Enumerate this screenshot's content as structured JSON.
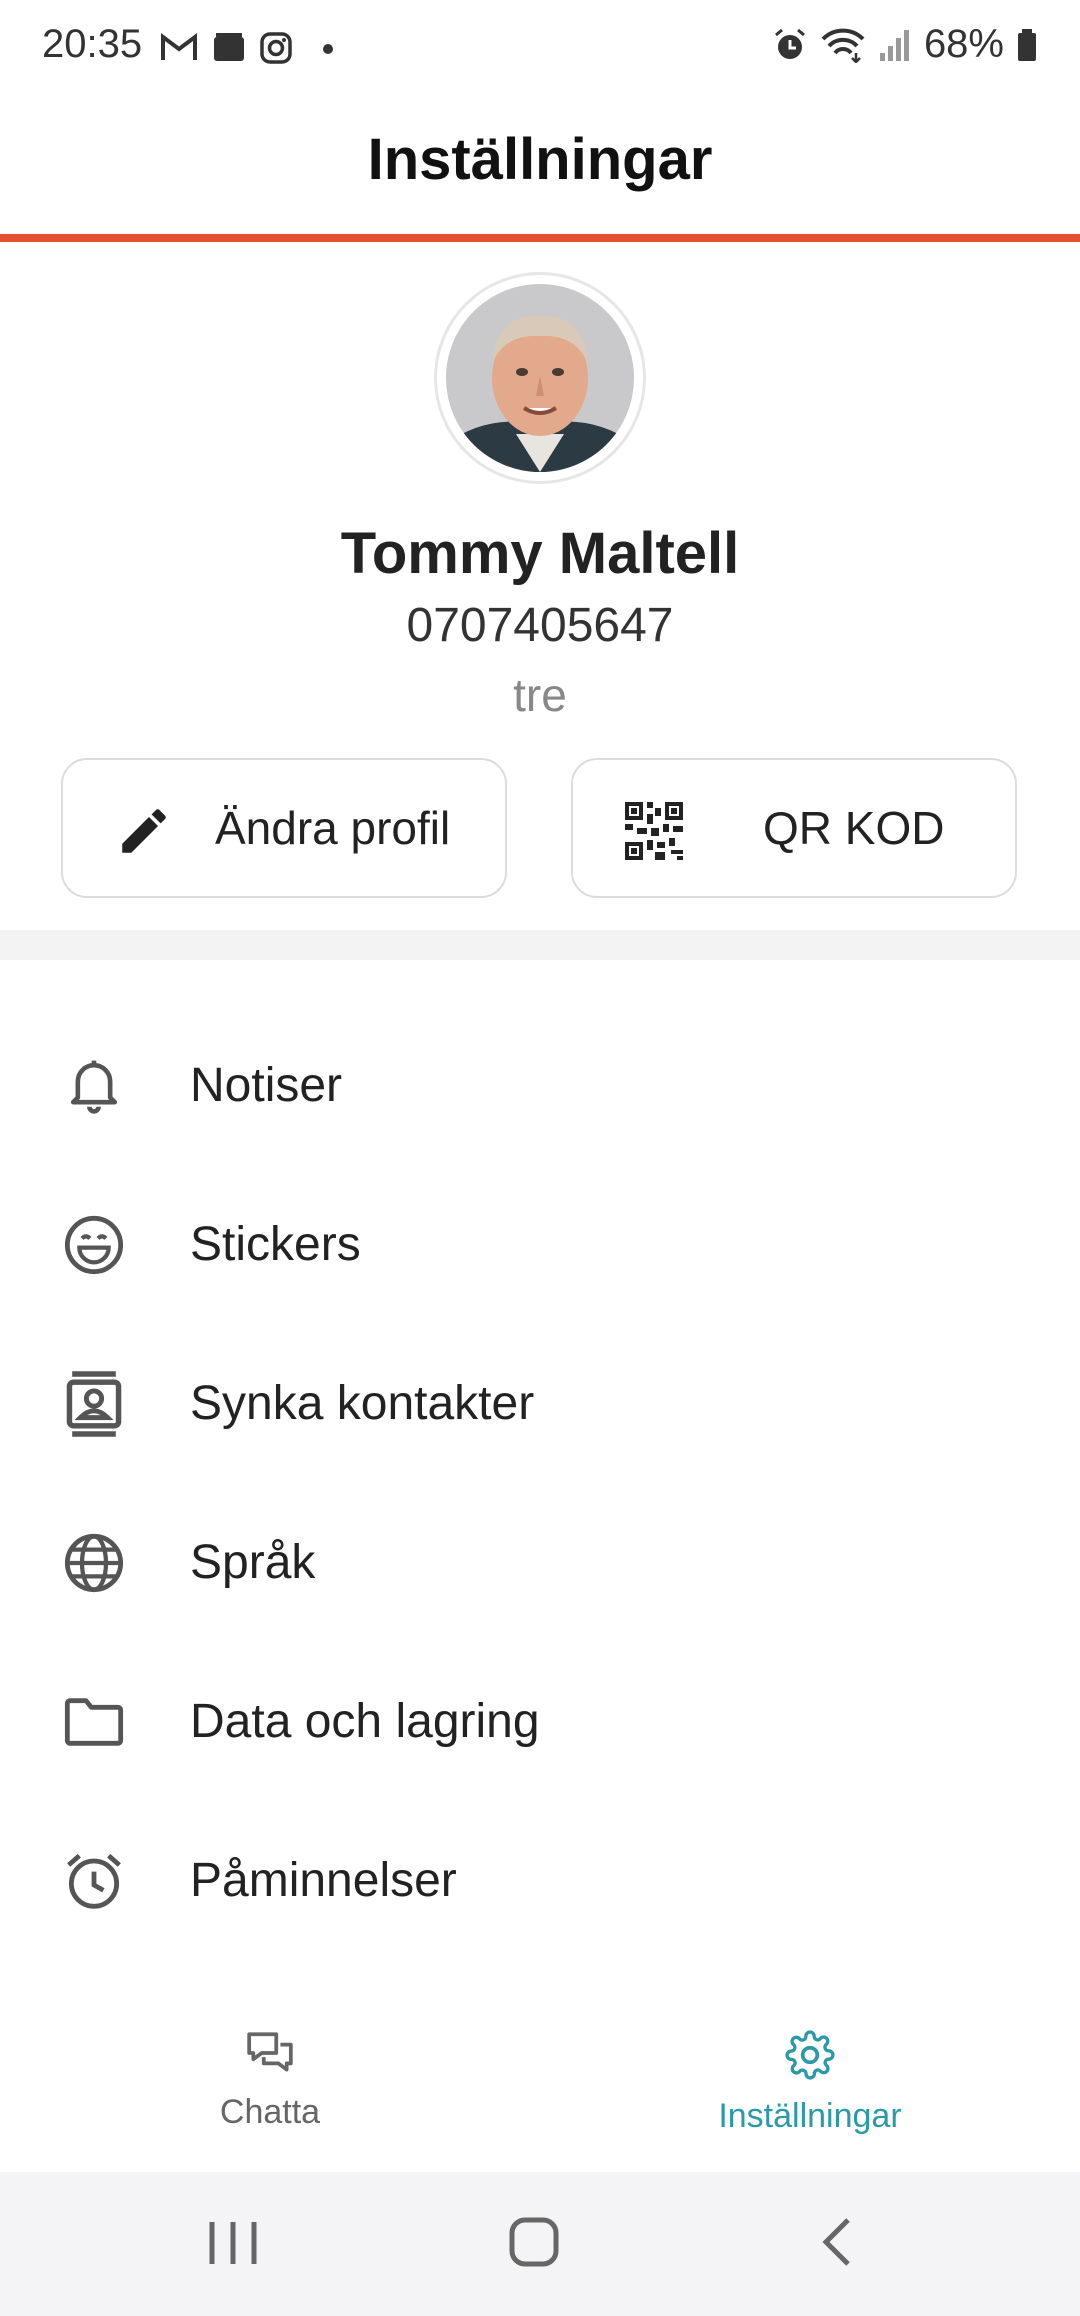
{
  "status_bar": {
    "time": "20:35",
    "icons": [
      "gmail-icon",
      "wallet-icon",
      "instagram-icon",
      "dot-icon"
    ],
    "right_icons": [
      "alarm-icon",
      "wifi-icon",
      "signal-icon"
    ],
    "battery": "68%"
  },
  "header": {
    "title": "Inställningar"
  },
  "colors": {
    "accent": "#e4502f",
    "active_tab": "#2a9aa8",
    "inactive_tab": "#666666"
  },
  "profile": {
    "name": "Tommy Maltell",
    "phone": "0707405647",
    "operator": "tre",
    "edit_button": "Ändra profil",
    "qr_button": "QR KOD"
  },
  "menu": {
    "items": [
      {
        "label": "Notiser",
        "icon": "bell-icon"
      },
      {
        "label": "Stickers",
        "icon": "smiley-icon"
      },
      {
        "label": "Synka kontakter",
        "icon": "contacts-icon"
      },
      {
        "label": "Språk",
        "icon": "globe-icon"
      },
      {
        "label": "Data och lagring",
        "icon": "folder-icon"
      },
      {
        "label": "Påminnelser",
        "icon": "alarm-clock-icon"
      }
    ]
  },
  "bottom_nav": {
    "tabs": [
      {
        "label": "Chatta",
        "icon": "chat-icon",
        "active": false
      },
      {
        "label": "Inställningar",
        "icon": "gear-icon",
        "active": true
      }
    ]
  }
}
